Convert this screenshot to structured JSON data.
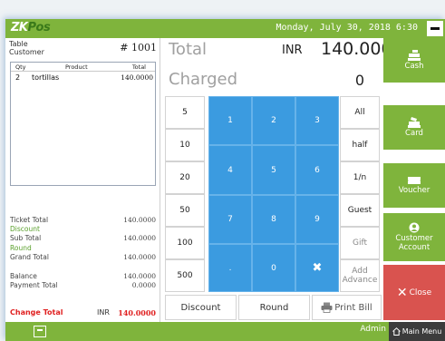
{
  "titlebar": {
    "logo_a": "ZK",
    "logo_b": "Pos",
    "datetime": "Monday, July 30, 2018 6:30"
  },
  "left": {
    "table_label": "Table",
    "customer_label": "Customer",
    "ticket_number": "# 1001",
    "columns": {
      "qty": "Qty",
      "product": "Product",
      "total": "Total"
    },
    "items": [
      {
        "qty": "2",
        "product": "tortillas",
        "total": "140.0000"
      }
    ],
    "totals": {
      "ticket_total_label": "Ticket Total",
      "ticket_total": "140.0000",
      "discount_label": "Discount",
      "sub_total_label": "Sub Total",
      "sub_total": "140.0000",
      "round_label": "Round",
      "grand_total_label": "Grand Total",
      "grand_total": "140.0000",
      "balance_label": "Balance",
      "balance": "140.0000",
      "payment_total_label": "Payment Total",
      "payment_total": "0.0000",
      "change_total_label": "Change Total",
      "change_currency": "INR",
      "change_total": "140.0000"
    }
  },
  "summary": {
    "total_label": "Total",
    "currency": "INR",
    "total_value": "140.0000",
    "charged_label": "Charged",
    "charged_value": "0"
  },
  "keypad": {
    "amounts": [
      "5",
      "10",
      "20",
      "50",
      "100",
      "500"
    ],
    "digits": [
      "1",
      "2",
      "3",
      "4",
      "5",
      "6",
      "7",
      "8",
      "9",
      ".",
      "0"
    ],
    "clear_icon": "✖",
    "actions": [
      "All",
      "half",
      "1/n",
      "Guest",
      "Gift",
      "Add Advance"
    ]
  },
  "bottom_buttons": {
    "discount": "Discount",
    "round": "Round",
    "print_bill": "Print Bill"
  },
  "payments": {
    "cash": "Cash",
    "card": "Card",
    "voucher": "Voucher",
    "customer_account": "Customer Account",
    "close": "Close"
  },
  "statusbar": {
    "admin": "Admin",
    "main_menu": "Main Menu"
  },
  "colors": {
    "accent_green": "#7fb43c",
    "key_blue": "#3b9be0",
    "close_red": "#d9534f",
    "change_red": "#e02020"
  }
}
